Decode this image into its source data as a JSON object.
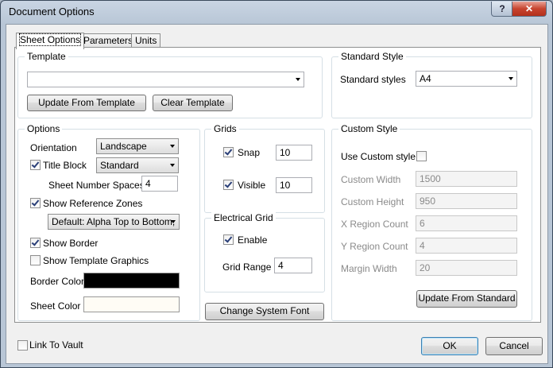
{
  "window": {
    "title": "Document Options",
    "help_label": "?",
    "close_label": "✕"
  },
  "tabs": [
    {
      "label": "Sheet Options",
      "active": true
    },
    {
      "label": "Parameters",
      "active": false
    },
    {
      "label": "Units",
      "active": false
    }
  ],
  "template": {
    "group_label": "Template",
    "value": "",
    "update_button": "Update From Template",
    "clear_button": "Clear Template"
  },
  "standard_style": {
    "group_label": "Standard Style",
    "label": "Standard styles",
    "value": "A4"
  },
  "options": {
    "group_label": "Options",
    "orientation_label": "Orientation",
    "orientation_value": "Landscape",
    "title_block_label": "Title Block",
    "title_block_checked": true,
    "title_block_value": "Standard",
    "sheet_number_spaces_label": "Sheet Number Spaces",
    "sheet_number_spaces_value": "4",
    "show_reference_zones_label": "Show Reference Zones",
    "show_reference_zones_checked": true,
    "reference_zones_value": "Default: Alpha Top to Bottom,",
    "show_border_label": "Show Border",
    "show_border_checked": true,
    "show_template_graphics_label": "Show Template Graphics",
    "show_template_graphics_checked": false,
    "border_color_label": "Border Color",
    "border_color": "#000000",
    "sheet_color_label": "Sheet Color",
    "sheet_color": "#fffcf5"
  },
  "grids": {
    "group_label": "Grids",
    "snap_label": "Snap",
    "snap_checked": true,
    "snap_value": "10",
    "visible_label": "Visible",
    "visible_checked": true,
    "visible_value": "10"
  },
  "electrical_grid": {
    "group_label": "Electrical Grid",
    "enable_label": "Enable",
    "enable_checked": true,
    "grid_range_label": "Grid Range",
    "grid_range_value": "4"
  },
  "change_font_button": "Change System Font",
  "custom_style": {
    "group_label": "Custom Style",
    "use_label": "Use Custom style",
    "use_checked": false,
    "fields": [
      {
        "label": "Custom Width",
        "value": "1500"
      },
      {
        "label": "Custom Height",
        "value": "950"
      },
      {
        "label": "X Region Count",
        "value": "6"
      },
      {
        "label": "Y Region Count",
        "value": "4"
      },
      {
        "label": "Margin Width",
        "value": "20"
      }
    ],
    "update_button": "Update From Standard"
  },
  "footer": {
    "link_to_vault_label": "Link To Vault",
    "link_to_vault_checked": false,
    "ok_button": "OK",
    "cancel_button": "Cancel"
  }
}
